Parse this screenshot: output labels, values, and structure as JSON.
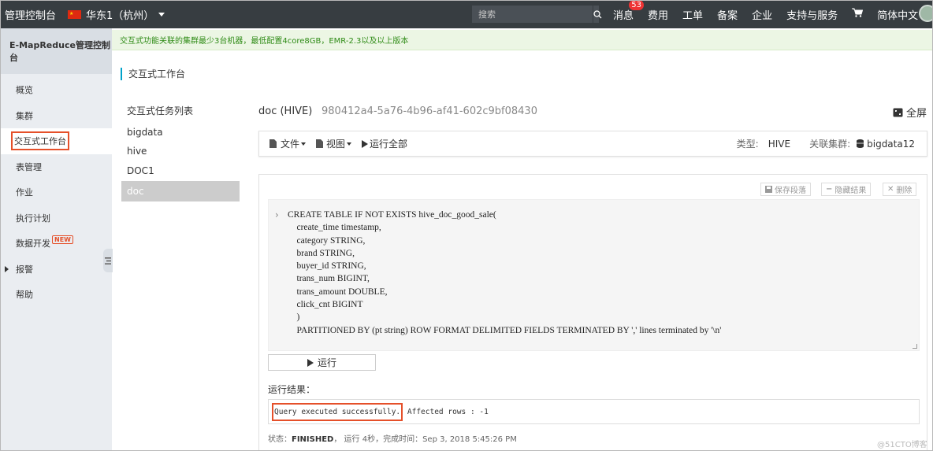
{
  "topbar": {
    "brand": "管理控制台",
    "region": "华东1（杭州）",
    "search_placeholder": "搜索",
    "nav": [
      "消息",
      "费用",
      "工单",
      "备案",
      "企业",
      "支持与服务"
    ],
    "message_badge": "53",
    "language": "简体中文"
  },
  "sidebar": {
    "title": "E-MapReduce管理控制台",
    "items": [
      "概览",
      "集群",
      "交互式工作台",
      "表管理",
      "作业",
      "执行计划",
      "数据开发",
      "报警",
      "帮助"
    ],
    "new_badge": "NEW"
  },
  "notice": "交互式功能关联的集群最少3台机器，最低配置4core8GB，EMR-2.3以及以上版本",
  "page_title": "交互式工作台",
  "task_list": {
    "heading": "交互式任务列表",
    "tasks": [
      "bigdata",
      "hive",
      "DOC1",
      "doc"
    ]
  },
  "doc": {
    "title": "doc (HIVE)",
    "id": "980412a4-5a76-4b96-af41-602c9bf08430",
    "fullscreen": "全屏"
  },
  "toolbar": {
    "file": "文件",
    "view": "视图",
    "run_all": "运行全部",
    "type_label": "类型:",
    "type_value": "HIVE",
    "cluster_label": "关联集群:",
    "cluster_value": "bigdata12"
  },
  "paragraph": {
    "save": "保存段落",
    "hide_result": "隐藏结果",
    "delete": "删除",
    "code": "CREATE TABLE IF NOT EXISTS hive_doc_good_sale(\n    create_time timestamp,\n    category STRING,\n    brand STRING,\n    buyer_id STRING,\n    trans_num BIGINT,\n    trans_amount DOUBLE,\n    click_cnt BIGINT\n    )\n    PARTITIONED BY (pt string) ROW FORMAT DELIMITED FIELDS TERMINATED BY ',' lines terminated by '\\n'",
    "run": "运行",
    "result_label": "运行结果：",
    "result_highlight": "Query executed successfully.",
    "result_rest": " Affected rows : -1",
    "status_prefix": "状态：",
    "status_value": "FINISHED",
    "status_rest": "， 运行 4秒，完成时间：Sep 3, 2018 5:45:26 PM"
  },
  "watermark": "@51CTO博客",
  "colors": {
    "topbar": "#373d41",
    "sidebar": "#eaedf1",
    "highlight": "#e5502a",
    "notice_text": "#2e8b16"
  }
}
